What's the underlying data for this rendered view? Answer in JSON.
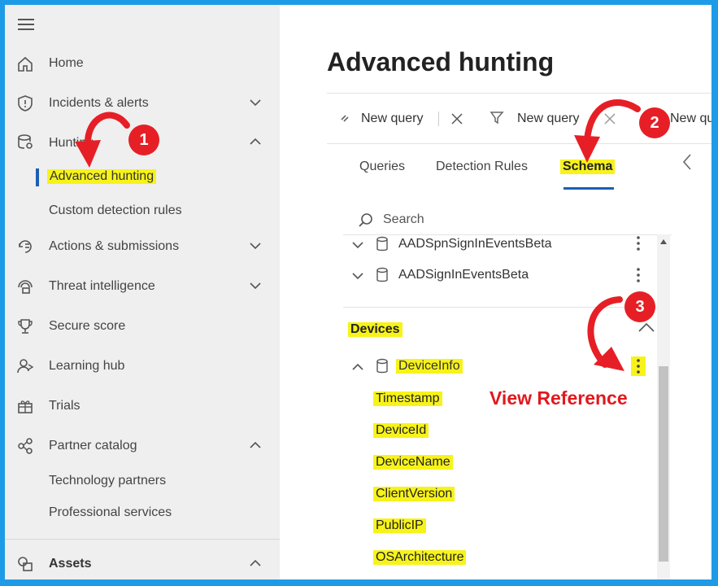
{
  "sidebar": {
    "menu_icon": "hamburger-icon",
    "items": [
      {
        "label": "Home",
        "icon": "home-icon"
      },
      {
        "label": "Incidents & alerts",
        "icon": "shield-icon"
      },
      {
        "label": "Hunting",
        "icon": "database-search-icon"
      },
      {
        "label": "Advanced hunting"
      },
      {
        "label": "Custom detection rules"
      },
      {
        "label": "Actions & submissions",
        "icon": "actions-icon"
      },
      {
        "label": "Threat intelligence",
        "icon": "threat-intel-icon"
      },
      {
        "label": "Secure score",
        "icon": "trophy-icon"
      },
      {
        "label": "Learning hub",
        "icon": "learning-icon"
      },
      {
        "label": "Trials",
        "icon": "gift-icon"
      },
      {
        "label": "Partner catalog",
        "icon": "partner-icon"
      },
      {
        "label": "Technology partners"
      },
      {
        "label": "Professional services"
      },
      {
        "label": "Assets",
        "icon": "assets-icon"
      }
    ]
  },
  "main": {
    "title": "Advanced hunting",
    "toolbar": {
      "query1": "New query",
      "query2": "New query",
      "query3": "New qu"
    },
    "tabs": [
      "Queries",
      "Detection Rules",
      "Schema"
    ],
    "search_placeholder": "Search",
    "tables_top": [
      "AADSpnSignInEventsBeta",
      "AADSignInEventsBeta"
    ],
    "section": "Devices",
    "table": "DeviceInfo",
    "columns": [
      "Timestamp",
      "DeviceId",
      "DeviceName",
      "ClientVersion",
      "PublicIP",
      "OSArchitecture"
    ]
  },
  "annotations": {
    "step1": "1",
    "step2": "2",
    "step3": "3",
    "view_reference": "View Reference",
    "highlight_color": "#f7f31a",
    "arrow_color": "#e61f26"
  }
}
